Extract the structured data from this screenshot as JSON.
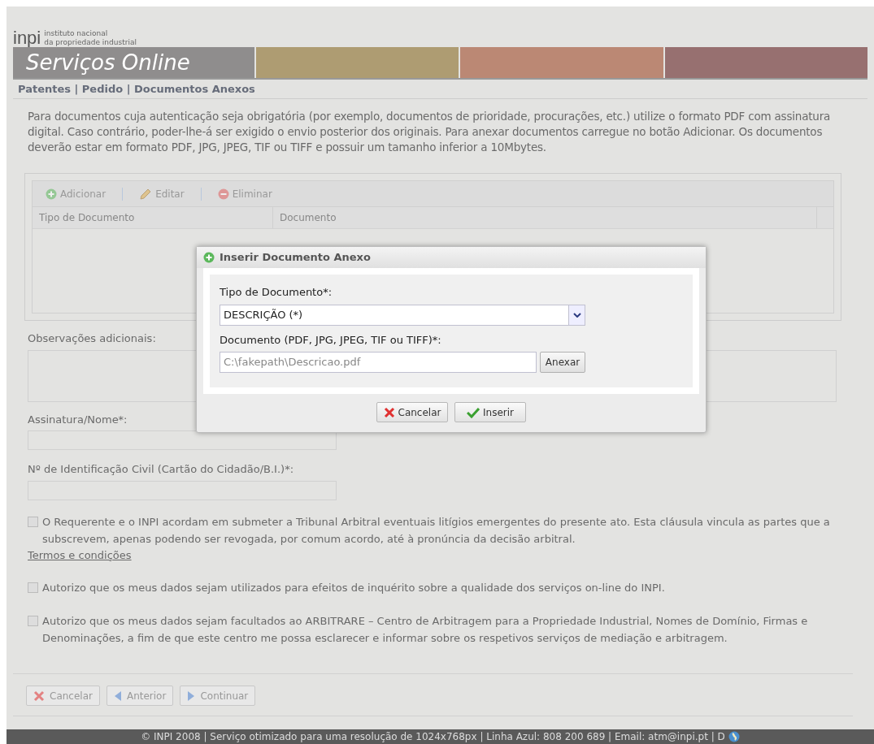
{
  "logo": {
    "mark": "inpi",
    "line1": "instituto nacional",
    "line2": "da propriedade industrial"
  },
  "banner": {
    "title": "Serviços Online",
    "stripes": [
      {
        "color": "#ae9c72"
      },
      {
        "color": "#bb8874"
      },
      {
        "color": "#977070"
      }
    ]
  },
  "breadcrumb": "Patentes | Pedido | Documentos Anexos",
  "intro": "Para documentos cuja autenticação seja obrigatória (por exemplo, documentos de prioridade, procurações, etc.) utilize o formato PDF com assinatura digital. Caso contrário, poder-lhe-á ser exigido o envio posterior dos originais. Para anexar documentos carregue no botão Adicionar. Os documentos deverão estar em formato PDF, JPG, JPEG, TIF ou TIFF e possuir um tamanho inferior a 10Mbytes.",
  "grid": {
    "toolbar": [
      {
        "kind": "add",
        "label": "Adicionar"
      },
      {
        "kind": "edit",
        "label": "Editar"
      },
      {
        "kind": "delete",
        "label": "Eliminar"
      }
    ],
    "columns": [
      "Tipo de Documento",
      "Documento"
    ]
  },
  "form": {
    "observations_label": "Observações adicionais:",
    "signature_label": "Assinatura/Nome*:",
    "id_label": "Nº de Identificação Civil (Cartão do Cidadão/B.I.)*:"
  },
  "agreements": [
    {
      "text": "O Requerente e o INPI acordam em submeter a Tribunal Arbitral eventuais litígios emergentes do presente ato. Esta cláusula vincula as partes que a subscrevem, apenas podendo ser revogada, por comum acordo, até à pronúncia da decisão arbitral.",
      "checked": false,
      "link": "Termos e condições"
    },
    {
      "text": "Autorizo que os meus dados sejam utilizados para efeitos de inquérito sobre a qualidade dos serviços on-line do INPI.",
      "checked": false
    },
    {
      "text": "Autorizo que os meus dados sejam facultados ao ARBITRARE – Centro de Arbitragem para a Propriedade Industrial, Nomes de Domínio, Firmas e Denominações, a fim de que este centro me possa esclarecer e informar sobre os respetivos serviços de mediação e arbitragem.",
      "checked": false
    }
  ],
  "nav_buttons": [
    {
      "kind": "cancel",
      "label": "Cancelar"
    },
    {
      "kind": "back",
      "label": "Anterior"
    },
    {
      "kind": "next",
      "label": "Continuar"
    }
  ],
  "footer": "© INPI 2008 | Serviço otimizado para uma resolução de 1024x768px | Linha Azul: 808 200 689 | Email: atm@inpi.pt | D",
  "dialog": {
    "title": "Inserir Documento Anexo",
    "type_label": "Tipo de Documento*:",
    "type_value": "DESCRIÇÃO (*)",
    "file_label": "Documento (PDF, JPG, JPEG, TIF ou TIFF)*:",
    "file_value": "C:\\fakepath\\Descricao.pdf",
    "attach_button": "Anexar",
    "buttons": [
      {
        "kind": "cancel",
        "label": "Cancelar"
      },
      {
        "kind": "ok",
        "label": "Inserir"
      }
    ]
  }
}
